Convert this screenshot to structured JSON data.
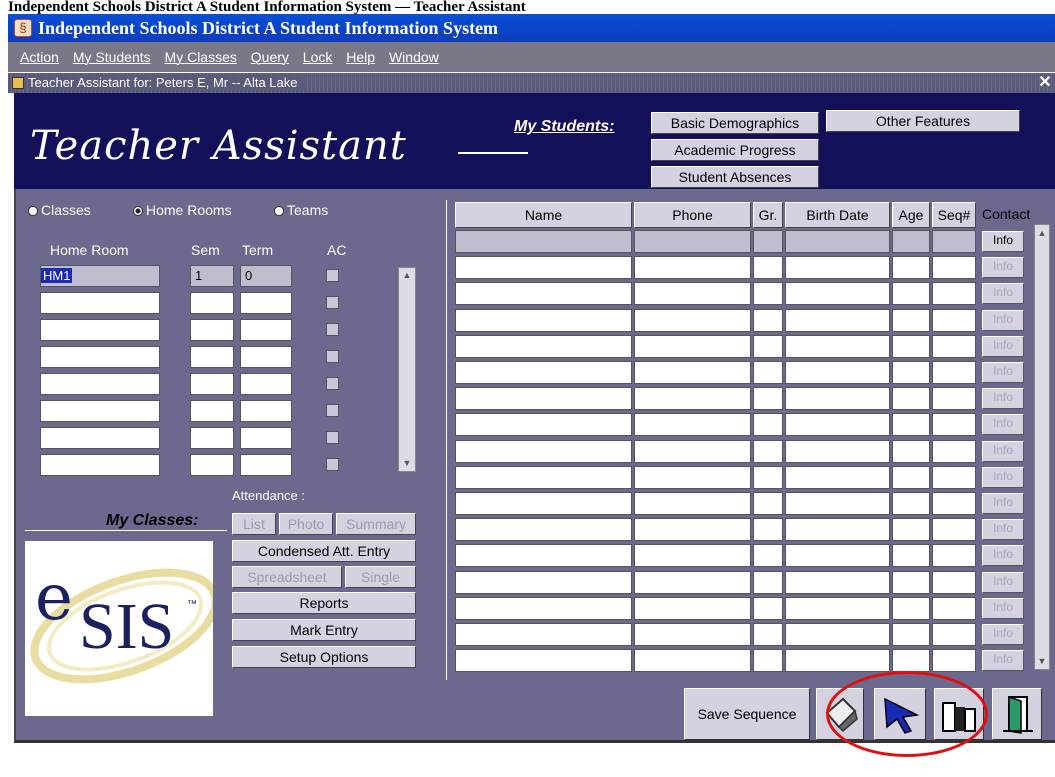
{
  "top_caption": "Independent Schools District A Student Information System — Teacher Assistant",
  "app": {
    "title": "Independent Schools District A Student Information System"
  },
  "menu": [
    "Action",
    "My Students",
    "My Classes",
    "Query",
    "Lock",
    "Help",
    "Window"
  ],
  "subwindow": {
    "title": "Teacher Assistant for: Peters E, Mr -- Alta Lake",
    "close": "✕"
  },
  "banner": {
    "title": "Teacher Assistant",
    "my_students_label": "My Students:",
    "buttons": {
      "basic_demographics": "Basic Demographics",
      "academic_progress": "Academic Progress",
      "student_absences": "Student Absences",
      "other_features": "Other Features"
    }
  },
  "view_options": {
    "classes": "Classes",
    "home_rooms": "Home Rooms",
    "teams": "Teams",
    "selected": "home_rooms"
  },
  "homeroom_table": {
    "headers": {
      "home_room": "Home Room",
      "sem": "Sem",
      "term": "Term",
      "ac": "AC"
    },
    "rows": [
      {
        "home_room": "HM1",
        "sem": "1",
        "term": "0"
      }
    ]
  },
  "attendance": {
    "label": "Attendance :",
    "list": "List",
    "photo": "Photo",
    "summary": "Summary",
    "condensed": "Condensed Att. Entry",
    "spreadsheet": "Spreadsheet",
    "single": "Single"
  },
  "my_classes": {
    "label": "My Classes:",
    "reports": "Reports",
    "mark_entry": "Mark Entry",
    "setup_options": "Setup Options"
  },
  "logo": {
    "e": "e",
    "sis": "SIS",
    "tm": "™"
  },
  "student_table": {
    "headers": {
      "name": "Name",
      "phone": "Phone",
      "gr": "Gr.",
      "birth_date": "Birth Date",
      "age": "Age",
      "seq": "Seq#",
      "contact": "Contact"
    },
    "info_label": "Info",
    "row_count": 16
  },
  "toolbar": {
    "save_sequence": "Save Sequence"
  },
  "colors": {
    "titlebar": "#0b3cb8",
    "banner": "#131059",
    "window": "#6b698d",
    "highlight": "#e01010"
  }
}
